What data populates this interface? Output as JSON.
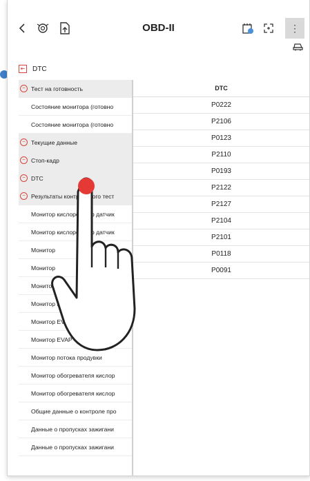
{
  "header": {
    "back_icon": "chevron-left-icon",
    "title": "OBD-II",
    "kebab": "⋮"
  },
  "breadcrumb": {
    "label": "DTC"
  },
  "tree": [
    {
      "label": "Тест на готовность",
      "kind": "group"
    },
    {
      "label": "Состояние монитора (готовно",
      "kind": "item"
    },
    {
      "label": "Состояние монитора (готовно",
      "kind": "item"
    },
    {
      "label": "Текущие данные",
      "kind": "group"
    },
    {
      "label": "Стоп-кадр",
      "kind": "group"
    },
    {
      "label": "DTC",
      "kind": "group"
    },
    {
      "label": "Результаты контрольного тест",
      "kind": "group"
    },
    {
      "label": "Монитор кислородного датчик",
      "kind": "item"
    },
    {
      "label": "Монитор кислородного датчик",
      "kind": "item"
    },
    {
      "label": "Монитор",
      "kind": "item"
    },
    {
      "label": "Монитор",
      "kind": "item"
    },
    {
      "label": "Монитор",
      "kind": "item"
    },
    {
      "label": "Монитор E",
      "kind": "item"
    },
    {
      "label": "Монитор EVAP",
      "kind": "item"
    },
    {
      "label": "Монитор EVAP - ...",
      "kind": "item"
    },
    {
      "label": "Монитор потока продувки",
      "kind": "item"
    },
    {
      "label": "Монитор обогревателя кислор",
      "kind": "item"
    },
    {
      "label": "Монитор обогревателя кислор",
      "kind": "item"
    },
    {
      "label": "Общие данные о контроле про",
      "kind": "item"
    },
    {
      "label": "Данные о пропусках зажигани",
      "kind": "item"
    },
    {
      "label": "Данные о пропусках зажигани",
      "kind": "item"
    }
  ],
  "dtc_table": {
    "header": "DTC",
    "codes": [
      "P0222",
      "P2106",
      "P0123",
      "P2110",
      "P0193",
      "P2122",
      "P2127",
      "P2104",
      "P2101",
      "P0118",
      "P0091"
    ]
  },
  "colors": {
    "accent_red": "#d9443a",
    "touch_red": "#e53935",
    "dot_blue": "#3f7ec8",
    "group_bg": "#ececec"
  }
}
